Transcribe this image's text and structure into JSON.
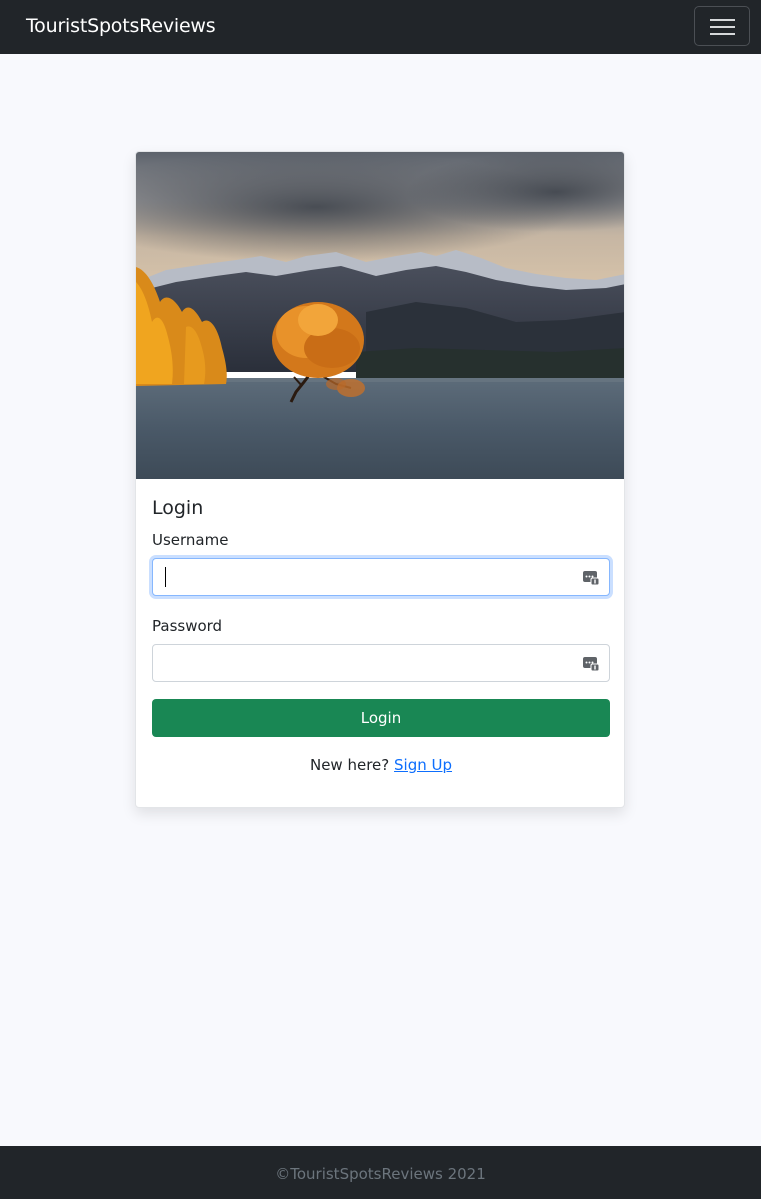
{
  "navbar": {
    "brand": "TouristSpotsReviews",
    "toggle_icon": "hamburger-menu-icon"
  },
  "card": {
    "image": "landscape-photo-lake-tree-mountains",
    "title": "Login",
    "username_label": "Username",
    "username_value": "",
    "password_label": "Password",
    "password_value": "",
    "field_icon": "password-manager-icon",
    "submit_label": "Login",
    "signup_prompt": "New here?",
    "signup_link": "Sign Up"
  },
  "footer": {
    "text": "©TouristSpotsReviews 2021"
  },
  "colors": {
    "navbar_bg": "#212529",
    "page_bg": "#f8f9fd",
    "button_bg": "#198754",
    "link": "#0d6efd",
    "focus_border": "#86b7fe"
  }
}
